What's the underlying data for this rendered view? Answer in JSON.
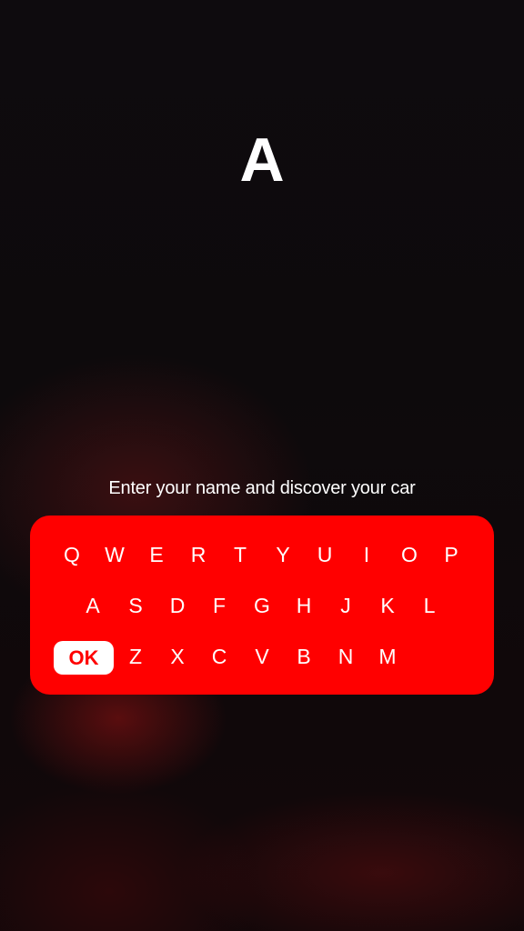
{
  "display": {
    "name_text": "A"
  },
  "prompt": {
    "text": "Enter your name and discover your car"
  },
  "keyboard": {
    "row1": [
      "Q",
      "W",
      "E",
      "R",
      "T",
      "Y",
      "U",
      "I",
      "O",
      "P"
    ],
    "row2": [
      "A",
      "S",
      "D",
      "F",
      "G",
      "H",
      "J",
      "K",
      "L"
    ],
    "row3": [
      "Z",
      "X",
      "C",
      "V",
      "B",
      "N",
      "M"
    ],
    "ok_label": "OK"
  },
  "colors": {
    "keyboard_bg": "#ff0000",
    "key_text": "#ffffff",
    "ok_bg": "#ffffff",
    "ok_text": "#ff0000"
  }
}
